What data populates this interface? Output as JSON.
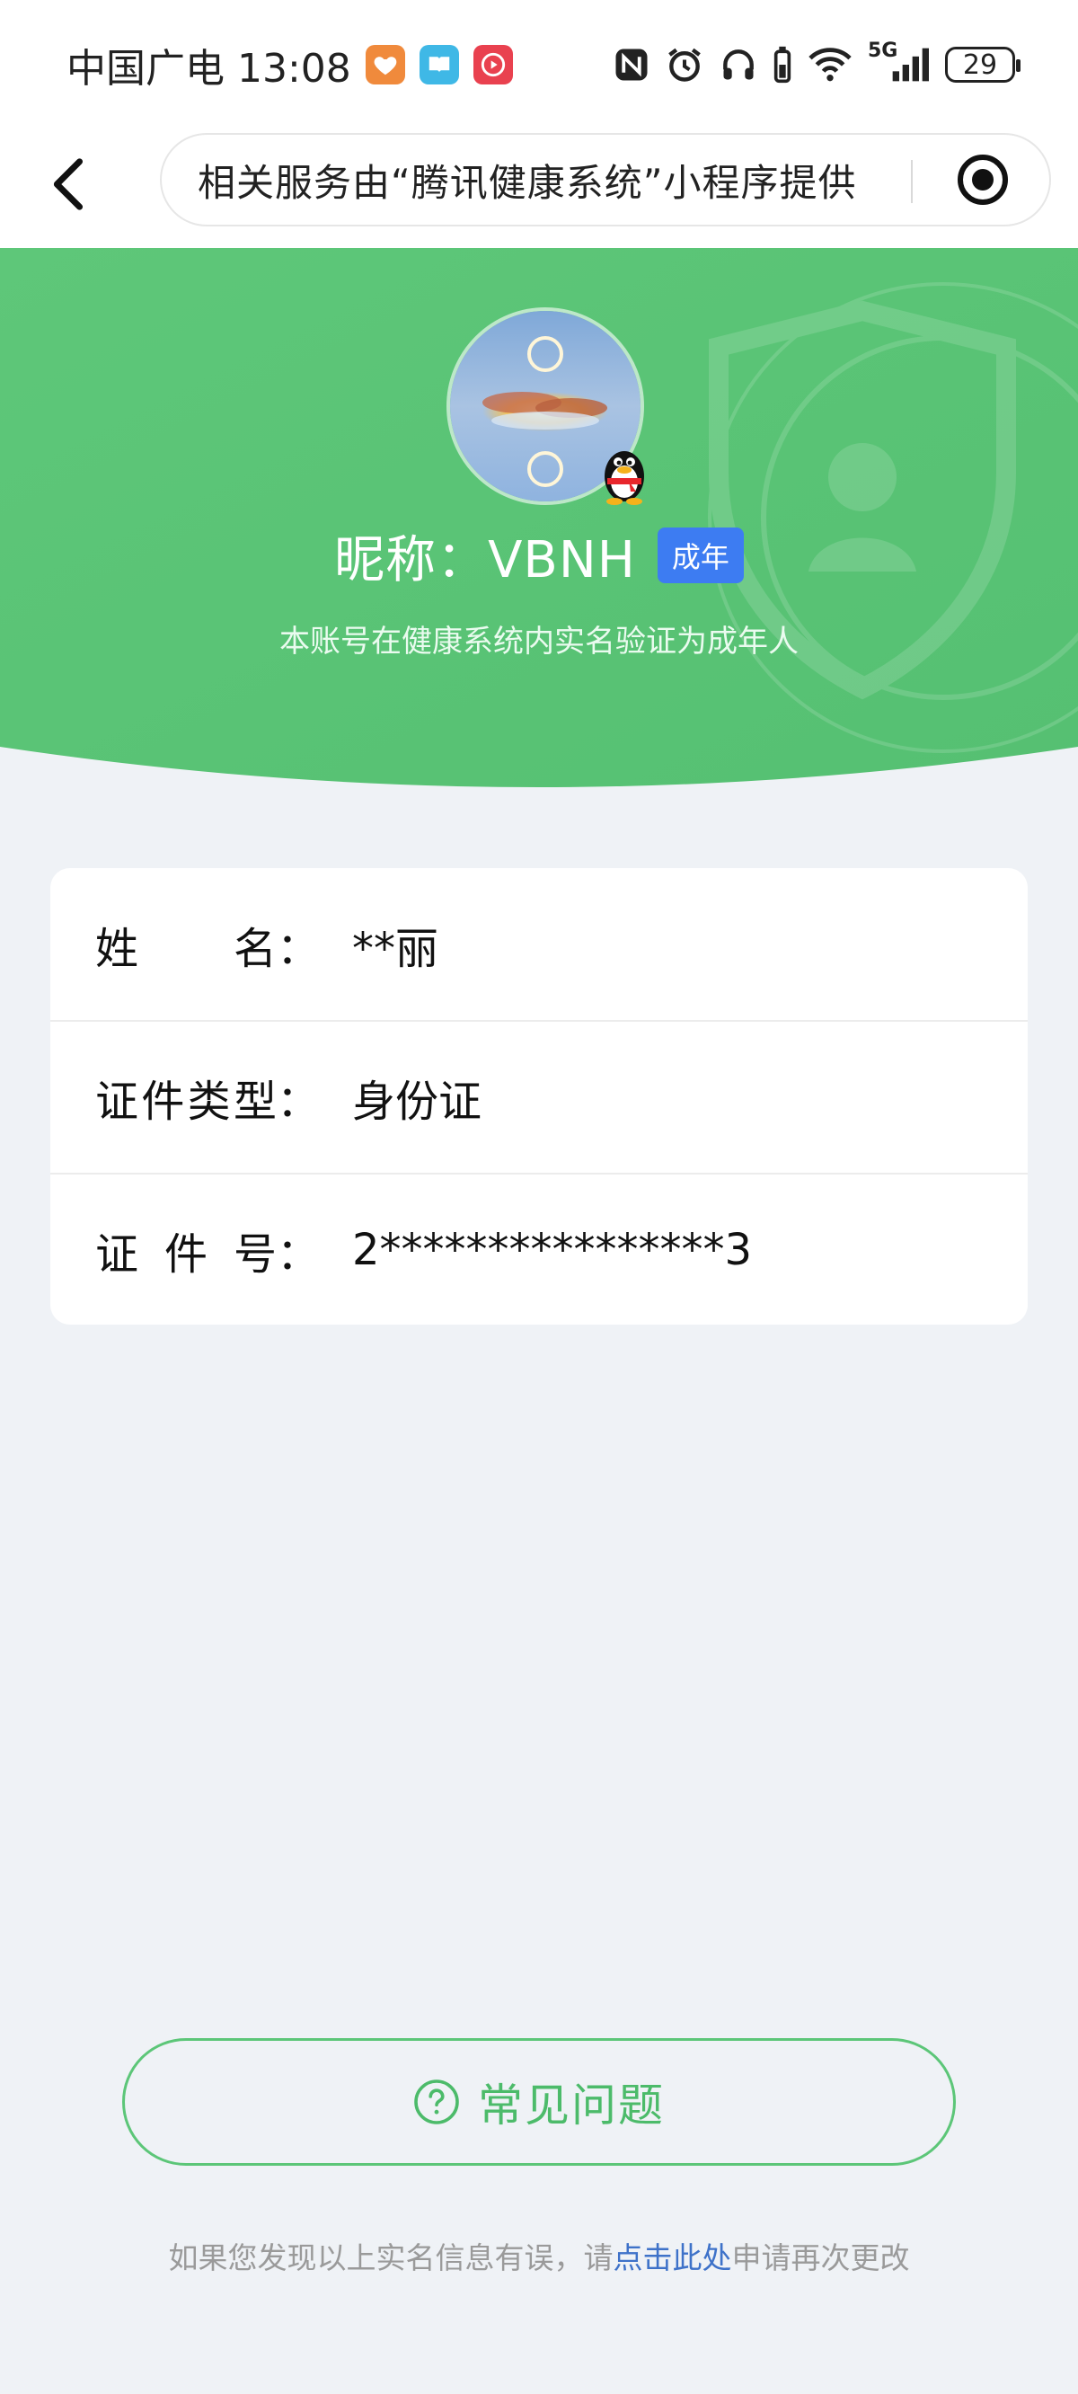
{
  "status_bar": {
    "carrier_time": "中国广电 13:08",
    "battery": "29",
    "network": "5G",
    "app_icons": [
      "heart-app-icon",
      "book-app-icon",
      "video-app-icon"
    ],
    "system_icons": [
      "nfc-icon",
      "alarm-icon",
      "headphones-icon",
      "battery-case-icon",
      "wifi-icon",
      "signal-icon"
    ]
  },
  "nav": {
    "title": "相关服务由“腾讯健康系统”小程序提供",
    "back_icon": "chevron-left-icon",
    "capsule_icon": "target-icon"
  },
  "profile": {
    "nickname": "昵称：VBNH",
    "age_badge": "成年",
    "verify_text": "本账号在健康系统内实名验证为成年人",
    "badge_icon": "qq-penguin-icon"
  },
  "info": {
    "rows": [
      {
        "label_chars": [
          "姓",
          "名",
          "："
        ],
        "value": "**丽"
      },
      {
        "label_chars": [
          "证",
          "件",
          "类",
          "型",
          "："
        ],
        "value": "身份证"
      },
      {
        "label_chars": [
          "证",
          "件",
          "号",
          "："
        ],
        "value": "2****************3"
      }
    ]
  },
  "faq": {
    "label": "常见问题",
    "icon": "question-circle-icon"
  },
  "footer": {
    "prefix": "如果您发现以上实名信息有误，请",
    "link": "点击此处",
    "suffix": "申请再次更改"
  },
  "colors": {
    "hero_green": "#5cc678",
    "badge_blue": "#3d7cf2",
    "link_blue": "#3e72c9",
    "page_bg": "#eff2f6"
  }
}
